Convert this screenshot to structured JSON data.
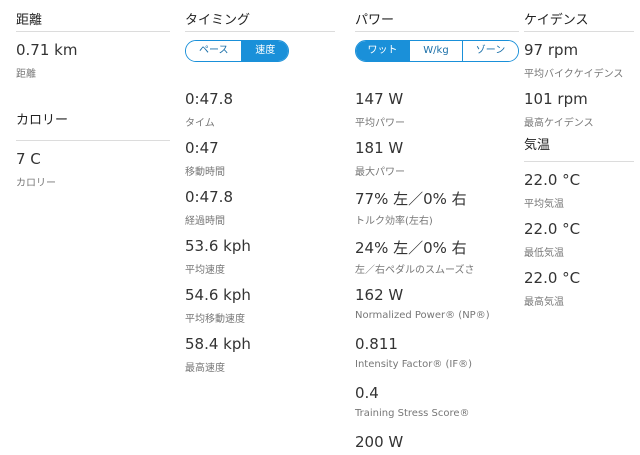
{
  "distance": {
    "header": "距離",
    "value": "0.71 km",
    "label": "距離"
  },
  "calories": {
    "header": "カロリー",
    "value": "7 C",
    "label": "カロリー"
  },
  "timing": {
    "header": "タイミング",
    "toggle": [
      "ペース",
      "速度"
    ],
    "toggle_selected": "速度",
    "stats": [
      {
        "value": "0:47.8",
        "label": "タイム"
      },
      {
        "value": "0:47",
        "label": "移動時間"
      },
      {
        "value": "0:47.8",
        "label": "経過時間"
      },
      {
        "value": "53.6 kph",
        "label": "平均速度"
      },
      {
        "value": "54.6 kph",
        "label": "平均移動速度"
      },
      {
        "value": "58.4 kph",
        "label": "最高速度"
      }
    ]
  },
  "power": {
    "header": "パワー",
    "toggle": [
      "ワット",
      "W/kg",
      "ゾーン"
    ],
    "toggle_selected": "ワット",
    "stats": [
      {
        "value": "147 W",
        "label": "平均パワー"
      },
      {
        "value": "181 W",
        "label": "最大パワー"
      },
      {
        "value": "77% 左／0% 右",
        "label": "トルク効率(左右)"
      },
      {
        "value": "24% 左／0% 右",
        "label": "左／右ペダルのスムーズさ"
      },
      {
        "value": "162 W",
        "label": "Normalized Power® (NP®)"
      },
      {
        "value": "0.811",
        "label": "Intensity Factor® (IF®)"
      },
      {
        "value": "0.4",
        "label": "Training Stress Score®"
      },
      {
        "value": "200 W",
        "label": ""
      }
    ]
  },
  "cadence": {
    "header": "ケイデンス",
    "stats": [
      {
        "value": "97 rpm",
        "label": "平均バイクケイデンス"
      },
      {
        "value": "101 rpm",
        "label": "最高ケイデンス"
      }
    ]
  },
  "temperature": {
    "header": "気温",
    "stats": [
      {
        "value": "22.0 °C",
        "label": "平均気温"
      },
      {
        "value": "22.0 °C",
        "label": "最低気温"
      },
      {
        "value": "22.0 °C",
        "label": "最高気温"
      }
    ]
  },
  "colors": {
    "accent": "#1a90d9",
    "divider": "#dcdcdc",
    "label": "#777777",
    "value": "#333333"
  }
}
